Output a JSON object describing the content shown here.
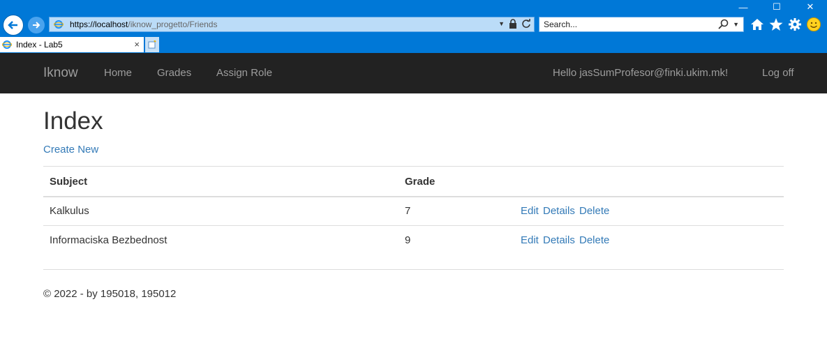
{
  "browser": {
    "url_host": "https://localhost",
    "url_path": "/iknow_progetto/Friends",
    "search_placeholder": "Search...",
    "tab_title": "Index - Lab5",
    "tab_close": "×",
    "window_buttons": [
      "—",
      "☐",
      "✕"
    ],
    "colors": {
      "chrome": "#0078d7",
      "address_bg": "#bbdcf8"
    }
  },
  "navbar": {
    "brand": "Iknow",
    "links": [
      "Home",
      "Grades",
      "Assign Role"
    ],
    "greeting": "Hello jasSumProfesor@finki.ukim.mk!",
    "logoff": "Log off"
  },
  "main": {
    "title": "Index",
    "create_new": "Create New",
    "table": {
      "headers": [
        "Subject",
        "Grade"
      ],
      "rows": [
        {
          "subject": "Kalkulus",
          "grade": "7",
          "actions": [
            "Edit",
            "Details",
            "Delete"
          ]
        },
        {
          "subject": "Informaciska Bezbednost",
          "grade": "9",
          "actions": [
            "Edit",
            "Details",
            "Delete"
          ]
        }
      ]
    }
  },
  "footer": {
    "text": "© 2022 - by 195018, 195012"
  }
}
